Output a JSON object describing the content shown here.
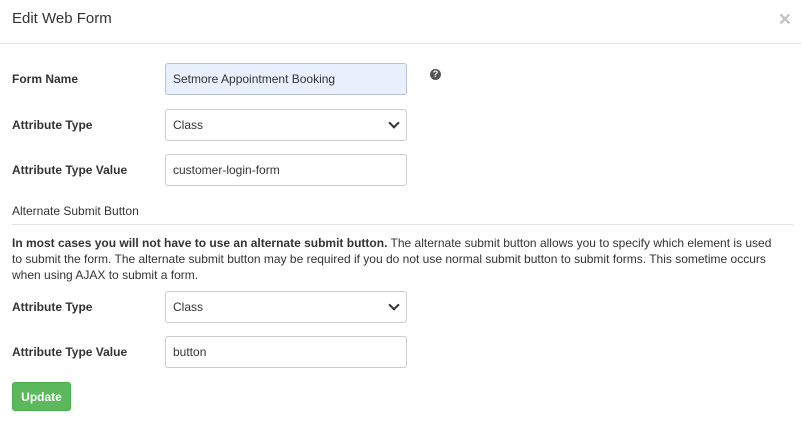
{
  "modal": {
    "title": "Edit Web Form",
    "close_icon": "close-icon",
    "close_glyph": "×"
  },
  "form_name": {
    "label": "Form Name",
    "value": "Setmore Appointment Booking",
    "help_icon": "question-circle-icon",
    "help_glyph": "?"
  },
  "attribute_type": {
    "label": "Attribute Type",
    "value": "Class"
  },
  "attribute_type_value": {
    "label": "Attribute Type Value",
    "value": "customer-login-form"
  },
  "alternate_submit": {
    "heading": "Alternate Submit Button",
    "info_bold": "In most cases you will not have to use an alternate submit button.",
    "info_text": " The alternate submit button allows you to specify which element is used to submit the form. The alternate submit button may be required if you do not use normal submit button to submit forms. This sometime occurs when using AJAX to submit a form.",
    "attribute_type": {
      "label": "Attribute Type",
      "value": "Class"
    },
    "attribute_type_value": {
      "label": "Attribute Type Value",
      "value": "button"
    }
  },
  "actions": {
    "update_label": "Update"
  },
  "colors": {
    "update_button": "#5cb85c",
    "autofill_background": "#e8f0fe"
  }
}
